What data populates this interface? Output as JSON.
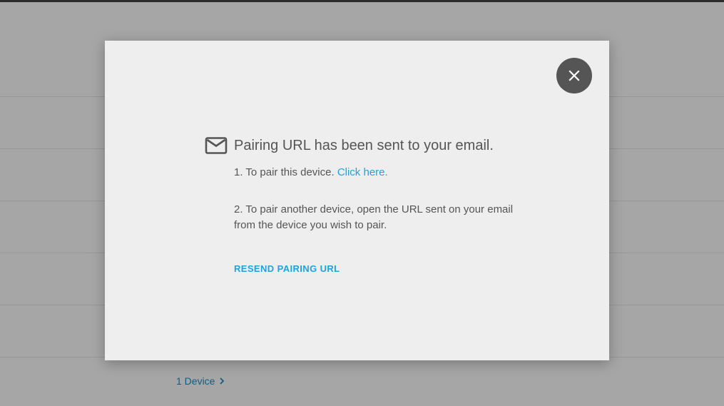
{
  "background": {
    "device_count_label": "1 Device"
  },
  "dialog": {
    "heading": "Pairing URL has been sent to your email.",
    "step1_text": "1. To pair this device.",
    "step1_link": "Click here.",
    "step2_text": "2. To pair another device, open the URL sent on your email from the device you wish to pair.",
    "resend_label": "RESEND PAIRING URL",
    "icons": {
      "close": "close-icon",
      "mail": "mail-icon",
      "chevron": "chevron-right-icon"
    }
  },
  "colors": {
    "overlay": "#a6a6a6",
    "dialog_bg": "#eeeeee",
    "accent": "#1fa3dc",
    "text": "#555555",
    "close_button": "#555555"
  }
}
